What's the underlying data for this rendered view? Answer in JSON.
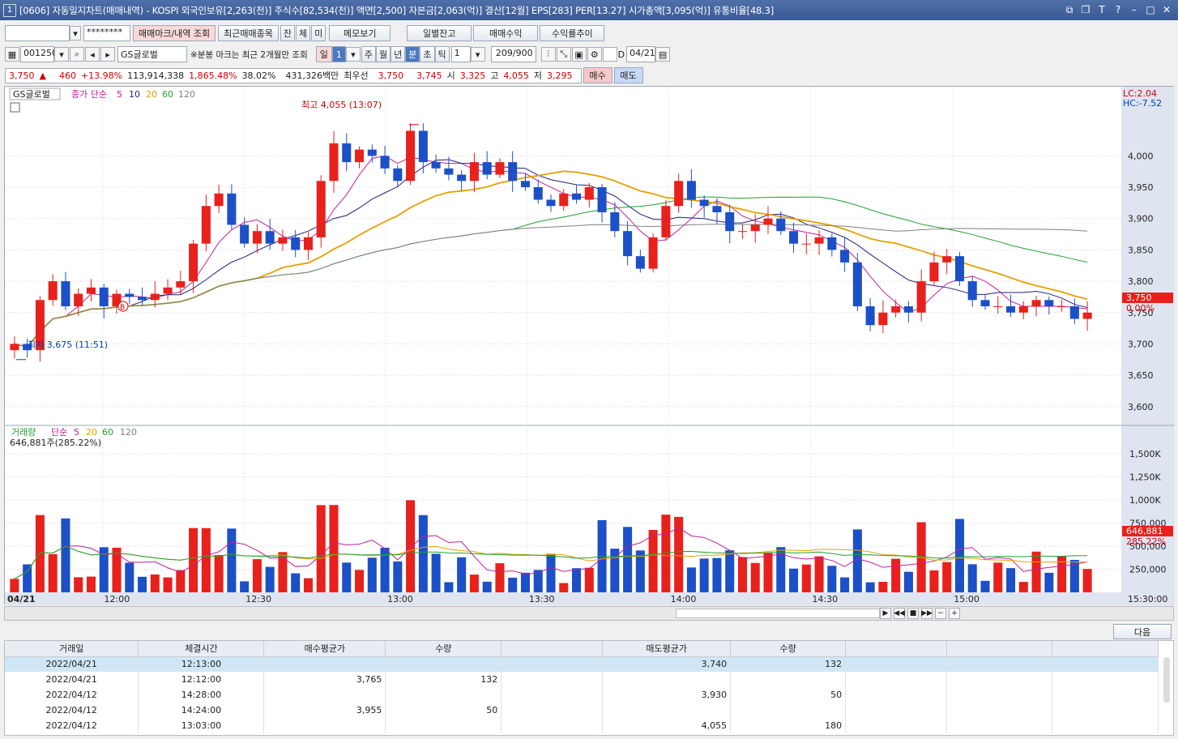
{
  "window": {
    "number": "1",
    "title": "[0606] 자동일지차트(매매내역) - KOSPI 외국인보유[2,263(천)] 주식수[82,534(천)] 액면[2,500] 자본금[2,063(억)] 결산[12월] EPS[283] PER[13.27] 시가총액[3,095(억)] 유통비율[48.3]"
  },
  "toolbar1": {
    "account_value": "",
    "password_mask": "********",
    "btn_trade_mark": "매매마크/내역 조회",
    "btn_recent": "최근매매종목",
    "btn_jan": "잔",
    "btn_che": "체",
    "btn_mi": "미",
    "btn_memo": "메모보기",
    "btn_daily_balance": "일별잔고",
    "btn_profit": "매매수익",
    "btn_return_trend": "수익률추이"
  },
  "toolbar2": {
    "code": "001250",
    "stock_name": "GS글로벌",
    "notice": "※분봉 마크는 최근 2개월만 조회",
    "period_il": "일",
    "period_num": "1",
    "period_ju": "주",
    "period_wol": "월",
    "period_nyeon": "년",
    "period_bun": "분",
    "period_cho": "초",
    "period_tik": "틱",
    "tick_num": "1",
    "count": "209/900",
    "d_label": "D",
    "date": "04/21"
  },
  "quote": {
    "price": "3,750",
    "change": "460",
    "change_pct": "+13.98%",
    "volume": "113,914,338",
    "vol_ratio": "1,865.48%",
    "turnover": "38.02%",
    "amount": "431,326백만",
    "best_ask_label": "최우선",
    "best_ask": "3,750",
    "best_bid": "3,745",
    "open_label": "시",
    "open": "3,325",
    "high_label": "고",
    "high": "4,055",
    "low_label": "저",
    "low": "3,295",
    "buy_btn": "매수",
    "sell_btn": "매도"
  },
  "price_panel": {
    "legend_name": "GS글로벌",
    "legend_ma": "종가 단순",
    "ma_periods": [
      "5",
      "10",
      "20",
      "60",
      "120"
    ],
    "lc": "LC:2.04",
    "hc": "HC:-7.52",
    "high_annot": "최고 4,055 (13:07)",
    "low_annot": "최저 3,675 (11:51)",
    "buy_marker": "B",
    "current_price": "3,750",
    "current_pct": "0.00%",
    "y_ticks": [
      "4,000",
      "3,950",
      "3,900",
      "3,850",
      "3,800",
      "3,750",
      "3,700",
      "3,650",
      "3,600"
    ]
  },
  "volume_panel": {
    "legend_name": "거래량",
    "legend_ma": "단순",
    "ma_periods": [
      "5",
      "20",
      "60",
      "120"
    ],
    "vol_text": "646,881주(285.22%)",
    "current_vol": "646,881",
    "current_vol_pct": "285.22%",
    "y_ticks": [
      "1,500K",
      "1,250K",
      "1,000K",
      "750,000",
      "500,000",
      "250,000"
    ]
  },
  "x_axis": {
    "date": "04/21",
    "ticks": [
      "12:00",
      "12:30",
      "13:00",
      "13:30",
      "14:00",
      "14:30",
      "15:00"
    ],
    "end": "15:30:00"
  },
  "next_btn": "다음",
  "table": {
    "headers": [
      "거래일",
      "체결시간",
      "매수평균가",
      "수량",
      "",
      "매도평균가",
      "수량",
      "",
      "",
      ""
    ],
    "rows": [
      [
        "2022/04/21",
        "12:13:00",
        "",
        "",
        "",
        "3,740",
        "132",
        "",
        "",
        ""
      ],
      [
        "2022/04/21",
        "12:12:00",
        "3,765",
        "132",
        "",
        "",
        "",
        "",
        "",
        ""
      ],
      [
        "2022/04/12",
        "14:28:00",
        "",
        "",
        "",
        "3,930",
        "50",
        "",
        "",
        ""
      ],
      [
        "2022/04/12",
        "14:24:00",
        "3,955",
        "50",
        "",
        "",
        "",
        "",
        "",
        ""
      ],
      [
        "2022/04/12",
        "13:03:00",
        "",
        "",
        "",
        "4,055",
        "180",
        "",
        "",
        ""
      ]
    ]
  },
  "colors": {
    "up": "#e8211c",
    "down": "#1c50c8",
    "ma5": "#c0209a",
    "ma10": "#202080",
    "ma20": "#e8a000",
    "ma60": "#20a030",
    "ma120": "#808080"
  },
  "chart_data": {
    "type": "candlestick",
    "x_range": [
      "11:40",
      "15:30"
    ],
    "price_ylim": [
      3570,
      4100
    ],
    "volume_ylim": [
      0,
      1700000
    ],
    "close_series_approx": [
      3700,
      3690,
      3770,
      3800,
      3760,
      3780,
      3790,
      3760,
      3780,
      3775,
      3770,
      3780,
      3790,
      3800,
      3860,
      3920,
      3940,
      3890,
      3860,
      3880,
      3860,
      3870,
      3850,
      3870,
      3960,
      4020,
      3990,
      4010,
      4000,
      3980,
      3960,
      4040,
      3990,
      3980,
      3970,
      3960,
      3990,
      3970,
      3990,
      3960,
      3950,
      3930,
      3920,
      3940,
      3930,
      3950,
      3910,
      3880,
      3840,
      3820,
      3870,
      3920,
      3960,
      3930,
      3920,
      3910,
      3880,
      3880,
      3890,
      3900,
      3880,
      3860,
      3860,
      3870,
      3850,
      3830,
      3760,
      3730,
      3750,
      3760,
      3750,
      3800,
      3830,
      3840,
      3800,
      3770,
      3760,
      3760,
      3750,
      3760,
      3770,
      3760,
      3760,
      3740,
      3750
    ],
    "annotations": {
      "high": {
        "label": "최고 4,055 (13:07)",
        "value": 4055
      },
      "low": {
        "label": "최저 3,675 (11:51)",
        "value": 3675
      }
    }
  }
}
